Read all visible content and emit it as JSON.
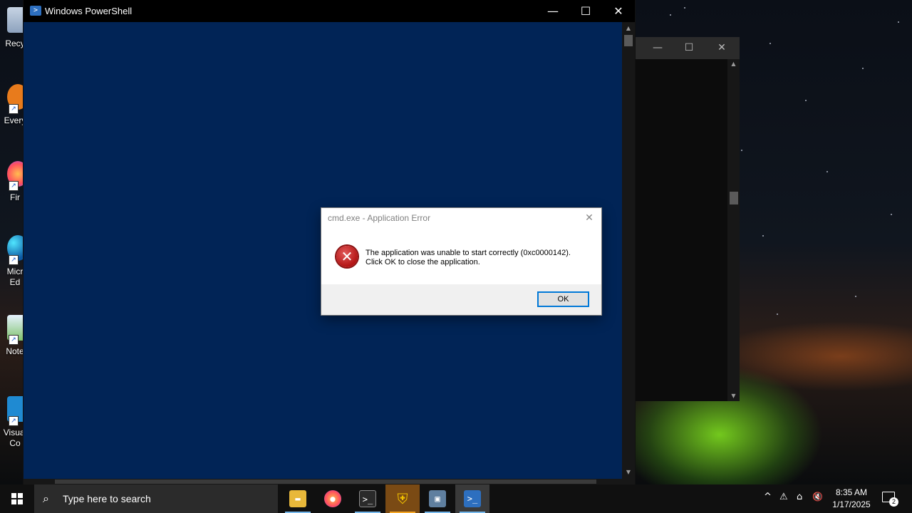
{
  "desktop": {
    "icons": [
      {
        "label": "Recy",
        "icon": "recycle-bin-icon"
      },
      {
        "label": "Every",
        "icon": "everything-app-icon"
      },
      {
        "label": "Fir",
        "icon": "firefox-icon"
      },
      {
        "label": "Micr\nEd",
        "icon": "edge-icon"
      },
      {
        "label": "Note",
        "icon": "notepad-icon"
      },
      {
        "label": "Visual\nCo",
        "icon": "vscode-icon"
      }
    ]
  },
  "console_back": {
    "minimize": "—",
    "maximize": "☐",
    "close": "✕"
  },
  "powershell": {
    "title": "Windows PowerShell",
    "minimize": "—",
    "maximize": "☐",
    "close": "✕"
  },
  "dialog": {
    "title": "cmd.exe - Application Error",
    "message_line1": "The application was unable to start correctly (0xc0000142).",
    "message_line2": "Click OK to close the application.",
    "ok_label": "OK",
    "close": "✕"
  },
  "taskbar": {
    "search_placeholder": "Type here to search",
    "apps": [
      {
        "name": "file-explorer",
        "glyph": "▬",
        "color": "#e8b83a"
      },
      {
        "name": "firefox",
        "glyph": "●",
        "color": "#ff6a1f"
      },
      {
        "name": "terminal",
        "glyph": ">_",
        "color": "#2a2a2a"
      },
      {
        "name": "security-shield",
        "glyph": "⛨",
        "color": "#f0b400"
      },
      {
        "name": "window-app",
        "glyph": "▣",
        "color": "#5f7f9f"
      },
      {
        "name": "powershell",
        "glyph": ">_",
        "color": "#2d6fbf"
      }
    ],
    "tray": {
      "chevron": "^",
      "security": "⚠",
      "network": "⌂",
      "volume": "🔇"
    },
    "time": "8:35 AM",
    "date": "1/17/2025",
    "notification_count": "2"
  }
}
